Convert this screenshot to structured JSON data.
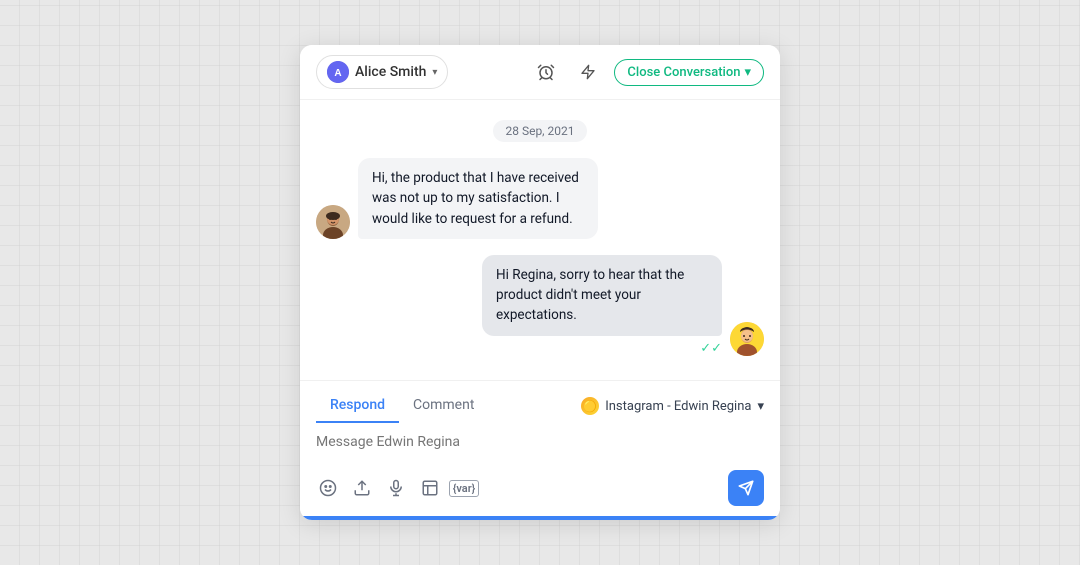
{
  "header": {
    "contact_name": "Alice Smith",
    "contact_avatar_letter": "A",
    "chevron_label": "▾",
    "alarm_icon": "alarm",
    "bolt_icon": "bolt",
    "close_btn_label": "Close Conversation",
    "close_btn_chevron": "▾"
  },
  "date_divider": "28 Sep, 2021",
  "messages": [
    {
      "id": "msg1",
      "direction": "incoming",
      "text": "Hi, the product that I have received was not up to my satisfaction. I would like to request for a refund.",
      "avatar_type": "incoming"
    },
    {
      "id": "msg2",
      "direction": "outgoing",
      "text": "Hi Regina, sorry to hear that the product didn't meet your expectations.",
      "avatar_type": "outgoing",
      "read": true
    }
  ],
  "footer": {
    "tabs": [
      {
        "id": "respond",
        "label": "Respond",
        "active": true
      },
      {
        "id": "comment",
        "label": "Comment",
        "active": false
      }
    ],
    "channel": {
      "icon": "🟡",
      "label": "Instagram - Edwin Regina",
      "chevron": "▾"
    },
    "input_placeholder": "Message Edwin Regina",
    "toolbar": {
      "emoji_icon": "emoji",
      "attach_icon": "attach",
      "audio_icon": "mic",
      "template_icon": "template",
      "var_icon": "{var}",
      "send_icon": "send"
    }
  }
}
